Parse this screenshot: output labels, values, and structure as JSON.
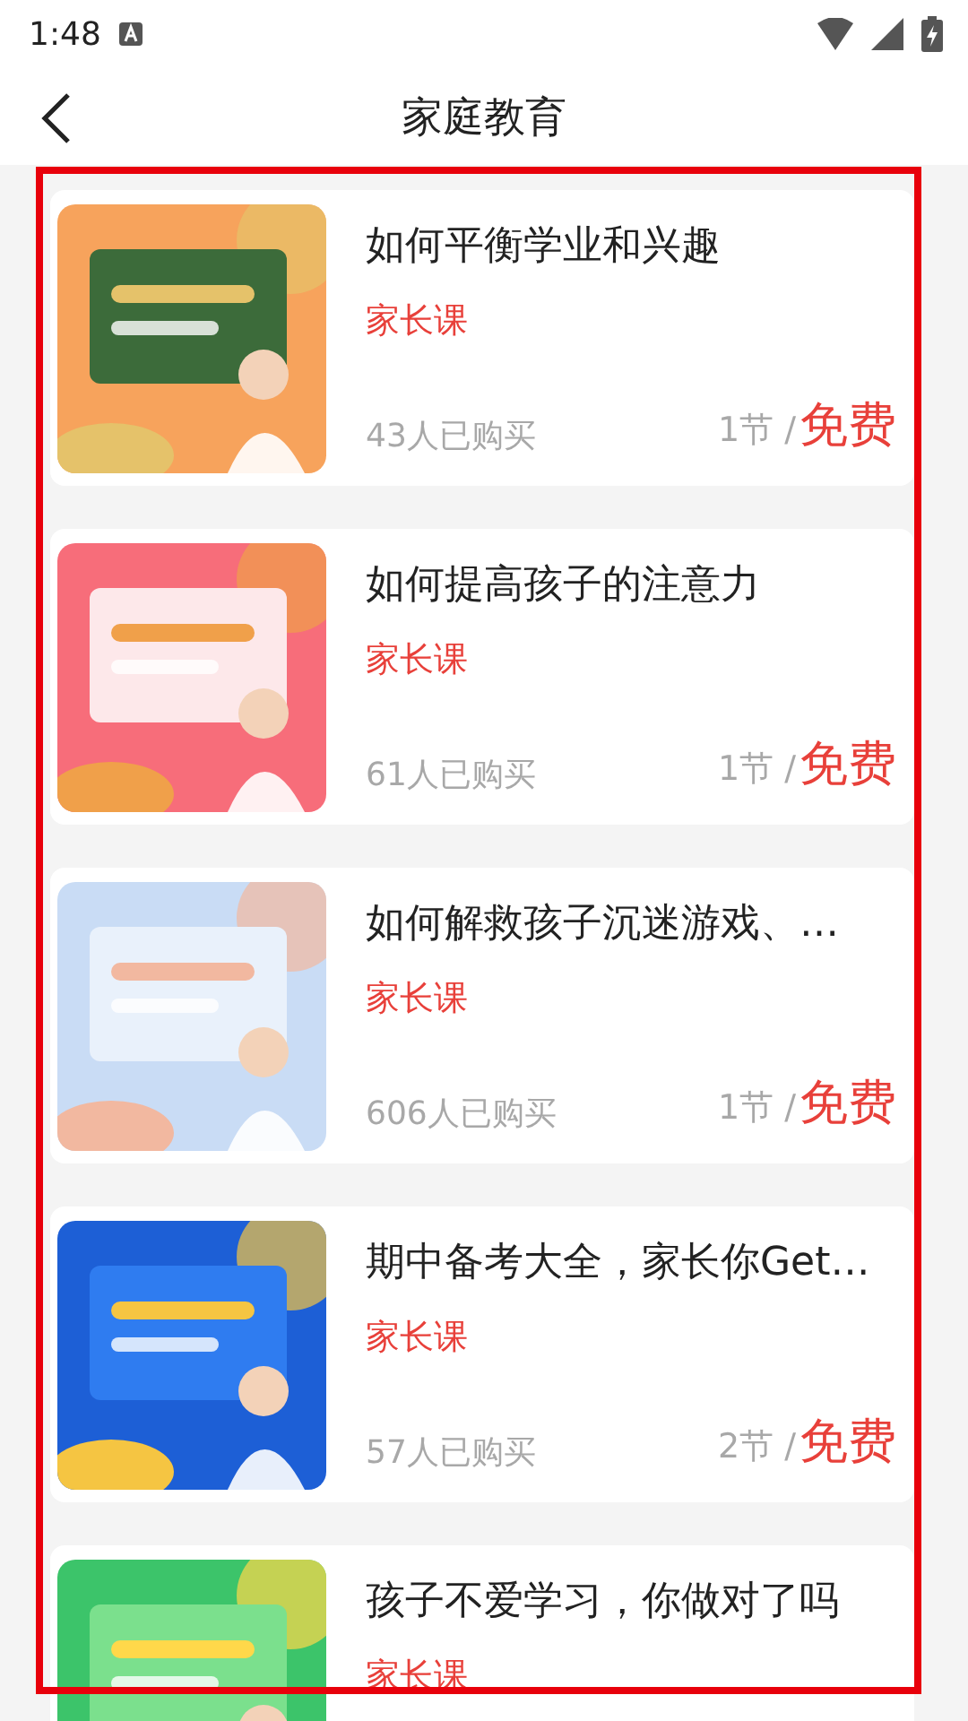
{
  "status_bar": {
    "time": "1:48"
  },
  "header": {
    "title": "家庭教育"
  },
  "courses": [
    {
      "title": "如何平衡学业和兴趣",
      "tag": "家长课",
      "buyers": "43人已购买",
      "lessons": "1节 /",
      "price": "免费"
    },
    {
      "title": "如何提高孩子的注意力",
      "tag": "家长课",
      "buyers": "61人已购买",
      "lessons": "1节 /",
      "price": "免费"
    },
    {
      "title": "如何解救孩子沉迷游戏、…",
      "tag": "家长课",
      "buyers": "606人已购买",
      "lessons": "1节 /",
      "price": "免费"
    },
    {
      "title": "期中备考大全，家长你Get…",
      "tag": "家长课",
      "buyers": "57人已购买",
      "lessons": "2节 /",
      "price": "免费"
    },
    {
      "title": "孩子不爱学习，你做对了吗",
      "tag": "家长课"
    }
  ]
}
